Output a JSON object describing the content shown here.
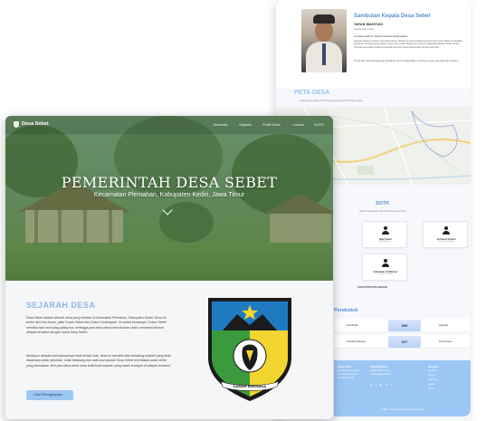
{
  "sambutan": {
    "title": "Sambutan Kepala Desa Sebet",
    "name": "YAYAN WAHYUDI",
    "role": "Kepala Desa Sebet",
    "greeting": "Assalamualaikum Warahmatullahi Wabarakatuh",
    "paragraphs": [
      "Selamat datang di website resmi Desa Sebet. Website ini hadir sebagai wujud komitmen kami dalam memberikan pelayanan informasi yang terbuka, cepat, dan mudah diakses oleh seluruh masyarakat. Melalui media ini kami berharap komunikasi antara pemerintah desa dan warga dapat terjalin dengan lebih baik.",
      "Terima kasih atas dukungan dan partisipasi seluruh warga dalam membangun desa yang maju dan sejahtera."
    ]
  },
  "peta": {
    "title": "PETA DESA",
    "subtitle": "Lokasi Desa Sebet di Peta Dengan Inovasi Peta Desa Sebet"
  },
  "sotk": {
    "title": "SOTK",
    "subtitle": "Struktur Organisasi dan Tata Kerja Desa Sebet",
    "cards": [
      {
        "name": "",
        "role": ""
      },
      {
        "name": "Sapi'yanto",
        "role": "Sekretaris Desa"
      },
      {
        "name": "Achmad Justari",
        "role": "Kasi Pemerintahan"
      },
      {
        "name": "",
        "role": ""
      },
      {
        "name": "Gunawan Al-Mansur",
        "role": "Kaur Keuangan"
      }
    ],
    "link": "LIHAT STRUKTUR LENGKAP"
  },
  "penduduk": {
    "title": "Penduduk",
    "rows": [
      {
        "label": "Penduduk",
        "value": "895",
        "label2": "Laki-laki"
      },
      {
        "label": "Kepala Keluarga",
        "value": "937",
        "label2": "Perempuan"
      }
    ]
  },
  "footer": {
    "col1_head": "Desa Sebet",
    "col1_lines": [
      "Pemerintah Desa Sebet",
      "Kecamatan Plemahan",
      "Kabupaten Kediri"
    ],
    "col2_head": "Hubungi Kami",
    "col2_lines": [
      "(0354) 123456 Sebet",
      "desasebet@gmail.com"
    ],
    "col3_head": "Navigasi",
    "col3_lines": [
      "Beranda",
      "Sejarah",
      "Profil Desa",
      "Lokasi",
      "SOTK"
    ],
    "social": "◎ f ▶ ✉ ♪",
    "copyright": "© 2024 · Powered by Pemerintah Desa Sebet"
  },
  "nav": {
    "brand": "Desa Sebet",
    "menu": [
      "Beranda",
      "Sejarah",
      "Profil Desa",
      "Lokasi",
      "SOTK"
    ]
  },
  "hero": {
    "title": "PEMERINTAH DESA SEBET",
    "subtitle": "Kecamatan Plemahan, Kabupaten Kediri, Jawa Timur"
  },
  "sejarah": {
    "title": "SEJARAH DESA",
    "paragraphs": [
      "Desa Sebet adalah sebuah desa yang terletak di Kecamatan Plemahan, Kabupaten Kediri. Desa ini terdiri dari dua dusun, yaitu Dusun Sebet dan Dusun Kedungsari. Di antara keduanya, Dusun Sebet memiliki asal usul yang paling tua, sehingga para tetua desa memutuskan untuk menamai seluruh wilayah tersebut dengan nama Desa Sebet.",
      "Meskipun wilayah permukimannya tidak terlalu luas, desa ini memiliki latar belakang sejarah yang telah diwariskan antar generasi. Latar belakang dan asal usul sejarah Desa Sebet diceritakan pada cerita yang diwariskan oleh para tetua desa serta bukti-bukti sejarah yang masih terdapat di wilayah tersebut."
    ],
    "button": "Lihat Selengkapnya →"
  },
  "emblem": {
    "motto": "DAMAR BREMANA"
  },
  "colors": {
    "accent": "#8bb6ea",
    "button": "#9cc7f4",
    "hero_overlay": "#468237"
  }
}
